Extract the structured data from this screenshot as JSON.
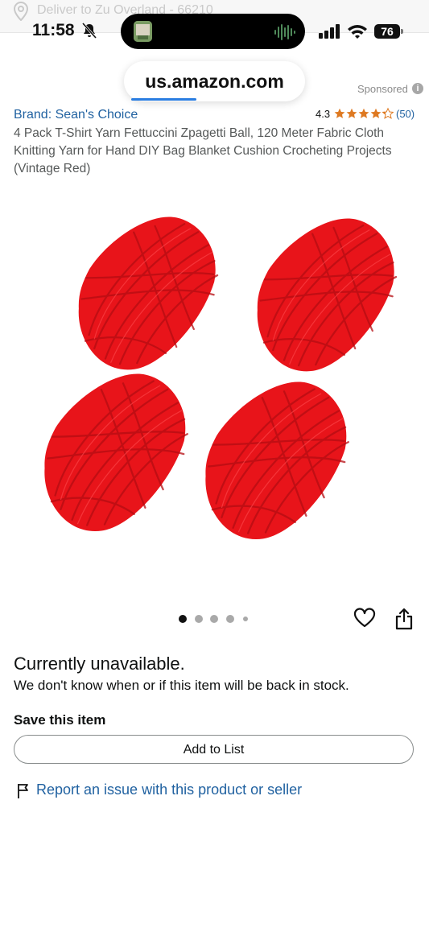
{
  "status_bar": {
    "time": "11:58",
    "battery": "76",
    "bell_icon": "bell-slash-icon",
    "signal_icon": "cellular-signal-icon",
    "wifi_icon": "wifi-icon"
  },
  "location_bar": {
    "text": "Deliver to Zu Overland - 66210",
    "icon": "location-pin-icon"
  },
  "browser": {
    "url": "us.amazon.com",
    "load_progress": 0.36
  },
  "sponsored": {
    "label": "Sponsored",
    "info_glyph": "i"
  },
  "product": {
    "brand": "Brand: Sean's Choice",
    "rating": "4.3",
    "stars_value": 4.3,
    "review_count": "(50)",
    "title": "4 Pack T-Shirt Yarn Fettuccini Zpagetti Ball, 120 Meter Fabric Cloth Knitting Yarn for Hand DIY Bag Blanket Cushion Crocheting Projects (Vintage Red)",
    "image_icon": "red-yarn-balls-image",
    "image_count": 5,
    "current_image": 1
  },
  "availability": {
    "status": "Currently unavailable.",
    "message": "We don't know when or if this item will be back in stock."
  },
  "save": {
    "heading": "Save this item",
    "button": "Add to List"
  },
  "report": {
    "link": "Report an issue with this product or seller",
    "icon": "flag-icon"
  },
  "colors": {
    "link": "#2162a1",
    "star": "#de7921",
    "yarn": "#e8141a"
  }
}
